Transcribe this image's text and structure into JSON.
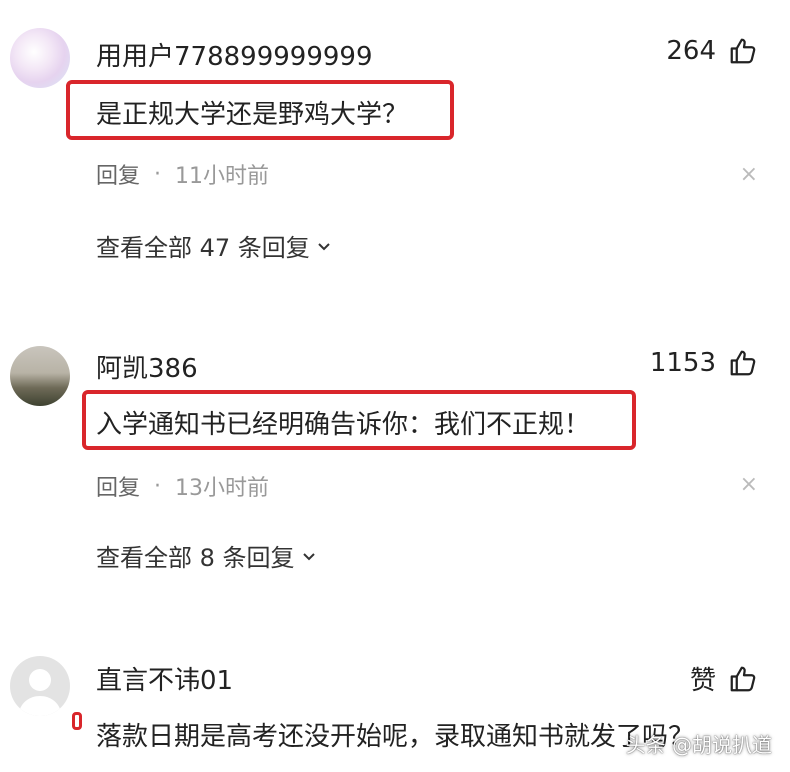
{
  "comments": [
    {
      "username": "用用户778899999999",
      "likes": "264",
      "text": "是正规大学还是野鸡大学？",
      "reply_label": "回复",
      "time": "11小时前",
      "view_all": "查看全部 47 条回复"
    },
    {
      "username": "阿凯386",
      "likes": "1153",
      "text": "入学通知书已经明确告诉你：我们不正规！",
      "reply_label": "回复",
      "time": "13小时前",
      "view_all": "查看全部 8 条回复"
    },
    {
      "username": "直言不讳01",
      "likes": "赞",
      "text": "落款日期是高考还没开始呢，录取通知书就发了吗？"
    }
  ],
  "separator": "·",
  "close_glyph": "×",
  "watermark": "头条 @胡说扒道",
  "colors": {
    "highlight": "#d9262b",
    "text": "#222222",
    "muted": "#999999"
  },
  "icons": {
    "like": "thumbs-up-icon",
    "close": "close-icon",
    "expand": "chevron-down-icon"
  }
}
